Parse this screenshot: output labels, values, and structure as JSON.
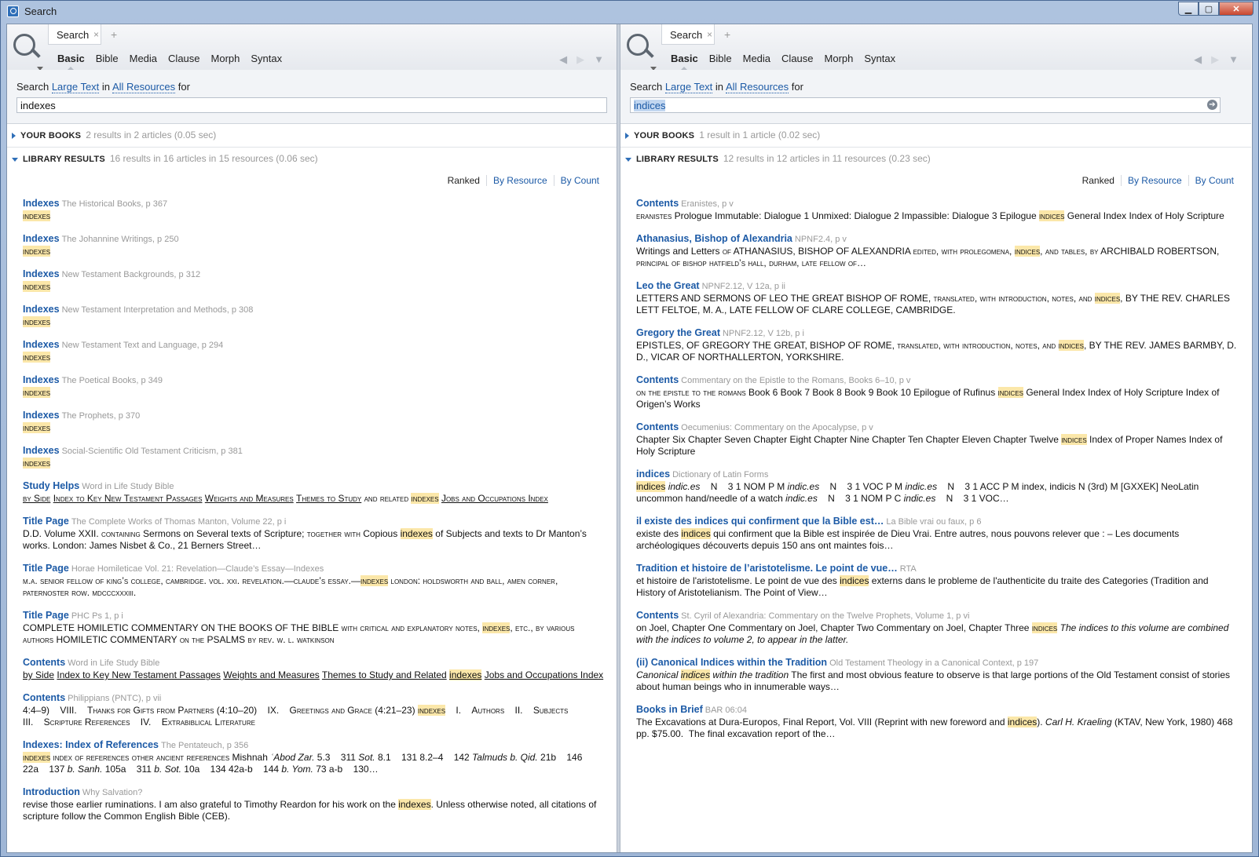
{
  "window": {
    "title": "Search"
  },
  "panels": {
    "left": {
      "tab": "Search",
      "tab_close": "×",
      "tab_add": "+",
      "subtabs": [
        "Basic",
        "Bible",
        "Media",
        "Clause",
        "Morph",
        "Syntax"
      ],
      "nav": {
        "back": "◀",
        "forward": "▶",
        "menu": "▼"
      },
      "search_prefix": "Search",
      "search_in": "in",
      "search_for": "for",
      "search_type": "Large Text",
      "search_scope": "All Resources",
      "query": "indexes",
      "your_books_label": "YOUR BOOKS",
      "your_books_info": "2 results in 2 articles (0.05 sec)",
      "library_label": "LIBRARY RESULTS",
      "library_info": "16 results in 16 articles in 15 resources (0.06 sec)",
      "sort": [
        "Ranked",
        "By Resource",
        "By Count"
      ],
      "results": [
        {
          "title": "Indexes",
          "source": "The Historical Books, p 367",
          "snippet": "<span class='hl sc'>indexes</span>"
        },
        {
          "title": "Indexes",
          "source": "The Johannine Writings, p 250",
          "snippet": "<span class='hl sc'>indexes</span>"
        },
        {
          "title": "Indexes",
          "source": "New Testament Backgrounds, p 312",
          "snippet": "<span class='hl sc'>indexes</span>"
        },
        {
          "title": "Indexes",
          "source": "New Testament Interpretation and Methods, p 308",
          "snippet": "<span class='hl sc'>indexes</span>"
        },
        {
          "title": "Indexes",
          "source": "New Testament Text and Language, p 294",
          "snippet": "<span class='hl sc'>indexes</span>"
        },
        {
          "title": "Indexes",
          "source": "The Poetical Books, p 349",
          "snippet": "<span class='hl sc'>indexes</span>"
        },
        {
          "title": "Indexes",
          "source": "The Prophets, p 370",
          "snippet": "<span class='hl sc'>indexes</span>"
        },
        {
          "title": "Indexes",
          "source": "Social-Scientific Old Testament Criticism, p 381",
          "snippet": "<span class='hl sc'>indexes</span>"
        },
        {
          "title": "Study Helps",
          "source": "Word in Life Study Bible",
          "snippet": "<span class='sc u'>by Side</span> <span class='sc u'>Index to Key New Testament Passages</span> <span class='sc u'>Weights and Measures</span> <span class='sc u'>Themes to Study</span> <span class='sc'>and related</span> <span class='hl sc'>indexes</span> <span class='sc u'>Jobs and Occupations Index</span>"
        },
        {
          "title": "Title Page",
          "source": "The Complete Works of Thomas Manton, Volume 22, p i",
          "snippet": "D.D. Volume XXII. <span class='sc'>containing</span> Sermons on Several texts of Scripture; <span class='sc'>together with</span> Copious <span class='hl'>indexes</span> of Subjects and texts to Dr Manton’s works. London: James Nisbet &amp; Co., 21 Berners Street…"
        },
        {
          "title": "Title Page",
          "source": "Horae Homileticae Vol. 21: Revelation—Claude’s Essay—Indexes",
          "snippet": "<span class='sc'>m.a. senior fellow of king’s college, cambridge. vol. xxi. revelation.—claude’s essay.—</span><span class='hl sc'>indexes</span> <span class='sc'>london: holdsworth and ball, amen corner, paternoster row. mdcccxxxiii.</span>"
        },
        {
          "title": "Title Page",
          "source": "PHC Ps 1, p i",
          "snippet": "COMPLETE HOMILETIC COMMENTARY ON THE BOOKS OF THE BIBLE <span class='sc'>with critical and explanatory notes,</span> <span class='hl sc'>indexes</span><span class='sc'>, etc., by various authors</span> HOMILETIC COMMENTARY <span class='sc'>on the</span> PSALMS <span class='sc'>by rev. w. l. watkinson</span>"
        },
        {
          "title": "Contents",
          "source": "Word in Life Study Bible",
          "snippet": "<span class='u'>by Side</span> <span class='u'>Index to Key New Testament Passages</span> <span class='u'>Weights and Measures</span> <span class='u'>Themes to Study and Related</span> <span class='hl u'>indexes</span> <span class='u'>Jobs and Occupations Index</span>"
        },
        {
          "title": "Contents",
          "source": "Philippians (PNTC), p vii",
          "snippet": "4:4–9)&nbsp;&nbsp;&nbsp;&nbsp;VIII.&nbsp;&nbsp;&nbsp;&nbsp;<span class='sc'>Thanks for Gifts from Partners (4:10–20)</span>&nbsp;&nbsp;&nbsp;&nbsp;IX.&nbsp;&nbsp;&nbsp;&nbsp;<span class='sc'>Greetings and Grace (4:21–23)</span> <span class='hl sc'>indexes</span>&nbsp;&nbsp;&nbsp;&nbsp;I.&nbsp;&nbsp;&nbsp;&nbsp;<span class='sc'>Authors</span>&nbsp;&nbsp;&nbsp;&nbsp;II.&nbsp;&nbsp;&nbsp;&nbsp;<span class='sc'>Subjects</span><br>III.&nbsp;&nbsp;&nbsp;&nbsp;<span class='sc'>Scripture References</span>&nbsp;&nbsp;&nbsp;&nbsp;IV.&nbsp;&nbsp;&nbsp;&nbsp;<span class='sc'>Extrabiblical Literature</span>"
        },
        {
          "title": "Indexes: Index of References",
          "source": "The Pentateuch, p 356",
          "snippet": "<span class='hl sc'>indexes</span> <span class='sc'>index of references other ancient references</span> Mishnah <span class='i'>ʿAbod Zar.</span> 5.3&nbsp;&nbsp;&nbsp;&nbsp;311 <span class='i'>Sot.</span> 8.1&nbsp;&nbsp;&nbsp;&nbsp;131 8.2–4&nbsp;&nbsp;&nbsp;&nbsp;142 <span class='i'>Talmuds b. Qid.</span> 21b&nbsp;&nbsp;&nbsp;&nbsp;146 22a&nbsp;&nbsp;&nbsp;&nbsp;137 <span class='i'>b. Sanh.</span> 105a&nbsp;&nbsp;&nbsp;&nbsp;311 <span class='i'>b. Sot.</span> 10a&nbsp;&nbsp;&nbsp;&nbsp;134 42a-b&nbsp;&nbsp;&nbsp;&nbsp;144 <span class='i'>b. Yom.</span> 73 a-b&nbsp;&nbsp;&nbsp;&nbsp;130…"
        },
        {
          "title": "Introduction",
          "source": "Why Salvation?",
          "snippet": "revise those earlier ruminations. I am also grateful to Timothy Reardon for his work on the <span class='hl'>indexes</span>. Unless otherwise noted, all citations of scripture follow the Common English Bible (CEB)."
        }
      ]
    },
    "right": {
      "tab": "Search",
      "tab_close": "×",
      "tab_add": "+",
      "subtabs": [
        "Basic",
        "Bible",
        "Media",
        "Clause",
        "Morph",
        "Syntax"
      ],
      "nav": {
        "back": "◀",
        "forward": "▶",
        "menu": "▼"
      },
      "search_prefix": "Search",
      "search_in": "in",
      "search_for": "for",
      "search_type": "Large Text",
      "search_scope": "All Resources",
      "query": "indices",
      "go": "➔",
      "your_books_label": "YOUR BOOKS",
      "your_books_info": "1 result in 1 article (0.02 sec)",
      "library_label": "LIBRARY RESULTS",
      "library_info": "12 results in 12 articles in 11 resources (0.23 sec)",
      "sort": [
        "Ranked",
        "By Resource",
        "By Count"
      ],
      "results": [
        {
          "title": "Contents",
          "source": "Eranistes, p v",
          "snippet": "<span class='sc'>eranistes</span> Prologue Immutable: Dialogue 1 Unmixed: Dialogue 2 Impassible: Dialogue 3 Epilogue <span class='hl sc'>indices</span> General Index Index of Holy Scripture"
        },
        {
          "title": "Athanasius, Bishop of Alexandria",
          "source": "NPNF2.4, p v",
          "snippet": "Writings and Letters <span class='sc'>of</span> ATHANASIUS, BISHOP OF ALEXANDRIA <span class='sc'>edited, with prolegomena,</span> <span class='hl sc'>indices</span><span class='sc'>, and tables, by</span> ARCHIBALD ROBERTSON, <span class='sc'>principal of bishop hatfield’s hall, durham, late fellow of…</span>"
        },
        {
          "title": "Leo the Great",
          "source": "NPNF2.12, V 12a, p ii",
          "snippet": "LETTERS AND SERMONS OF LEO THE GREAT BISHOP OF ROME, <span class='sc'>translated, with introduction, notes, and</span> <span class='hl sc'>indices</span>, BY THE REV. CHARLES LETT FELTOE, M. A., LATE FELLOW OF CLARE COLLEGE, CAMBRIDGE."
        },
        {
          "title": "Gregory the Great",
          "source": "NPNF2.12, V 12b, p i",
          "snippet": "EPISTLES, OF GREGORY THE GREAT, BISHOP OF ROME, <span class='sc'>translated, with introduction, notes, and</span> <span class='hl sc'>indices</span>, BY THE REV. JAMES BARMBY, D. D., VICAR OF NORTHALLERTON, YORKSHIRE."
        },
        {
          "title": "Contents",
          "source": "Commentary on the Epistle to the Romans, Books 6–10, p v",
          "snippet": "<span class='sc'>on the epistle to the romans</span> Book 6 Book 7 Book 8 Book 9 Book 10 Epilogue of Rufinus <span class='hl sc'>indices</span> General Index Index of Holy Scripture Index of Origen’s Works"
        },
        {
          "title": "Contents",
          "source": "Oecumenius: Commentary on the Apocalypse, p v",
          "snippet": "Chapter Six Chapter Seven Chapter Eight Chapter Nine Chapter Ten Chapter Eleven Chapter Twelve <span class='hl sc'>indices</span> Index of Proper Names Index of Holy Scripture"
        },
        {
          "title": "indices",
          "source": "Dictionary of Latin Forms",
          "snippet": "<span class='hl'>indices</span> <span class='i'>indic.es</span>&nbsp;&nbsp;&nbsp;&nbsp;N&nbsp;&nbsp;&nbsp;&nbsp;3 1 NOM P M <span class='i'>indic.es</span>&nbsp;&nbsp;&nbsp;&nbsp;N&nbsp;&nbsp;&nbsp;&nbsp;3 1 VOC P M <span class='i'>indic.es</span>&nbsp;&nbsp;&nbsp;&nbsp;N&nbsp;&nbsp;&nbsp;&nbsp;3 1 ACC P M index, indicis N (3rd) M [GXXEK] NeoLatin uncommon hand/needle of a watch <span class='i'>indic.es</span>&nbsp;&nbsp;&nbsp;&nbsp;N&nbsp;&nbsp;&nbsp;&nbsp;3 1 NOM P C <span class='i'>indic.es</span>&nbsp;&nbsp;&nbsp;&nbsp;N&nbsp;&nbsp;&nbsp;&nbsp;3 1 VOC…"
        },
        {
          "title": "il existe des indices qui confirment que la Bible est…",
          "source": "La Bible vrai ou faux, p 6",
          "snippet": "existe des <span class='hl'>indices</span> qui confirment que la Bible est inspirée de Dieu Vrai. Entre autres, nous pouvons relever que : – Les documents archéologiques découverts depuis 150 ans ont maintes fois…"
        },
        {
          "title": "Tradition et histoire de l’aristotelisme. Le point de vue…",
          "source": "RTA",
          "snippet": "et histoire de l'aristotelisme. Le point de vue des <span class='hl'>indices</span> externs dans le probleme de l'authenticite du traite des Categories (Tradition and History of Aristotelianism. The Point of View…"
        },
        {
          "title": "Contents",
          "source": "St. Cyril of Alexandria: Commentary on the Twelve Prophets, Volume 1, p vi",
          "snippet": "on Joel, Chapter One Commentary on Joel, Chapter Two Commentary on Joel, Chapter Three <span class='hl sc'>indices</span> <span class='i'>The indices to this volume are combined with the indices to volume 2, to appear in the latter.</span>"
        },
        {
          "title": "(ii) Canonical Indices within the Tradition",
          "source": "Old Testament Theology in a Canonical Context, p 197",
          "snippet": "<span class='i'>Canonical</span> <span class='hl i'>indices</span> <span class='i'>within the tradition</span> The first and most obvious feature to observe is that large portions of the Old Testament consist of stories about human beings who in innumerable ways…"
        },
        {
          "title": "Books in Brief",
          "source": "BAR 06:04",
          "snippet": "The Excavations at Dura-Europos, Final Report, Vol. VIII (Reprint with new foreword and <span class='hl'>indices</span>). <span class='i'>Carl H. Kraeling</span> (KTAV, New York, 1980) 468 pp. $75.00.&nbsp;&nbsp;The final excavation report of the…"
        }
      ]
    }
  },
  "colors": {
    "link": "#1c5aa6",
    "highlight": "#fbe7a9",
    "muted": "#999999"
  }
}
